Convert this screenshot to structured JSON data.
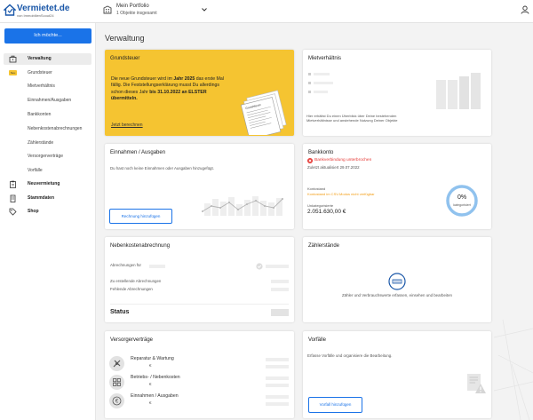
{
  "header": {
    "logo_title": "Vermietet.de",
    "logo_subtitle": "von ImmobilienScout24",
    "portfolio_title": "Mein Portfolio",
    "portfolio_subtitle": "1 Objekte insgesamt"
  },
  "sidebar": {
    "cta_label": "Ich möchte...",
    "items": [
      {
        "label": "Verwaltung",
        "active": true,
        "bold": true,
        "icon": "briefcase-icon"
      },
      {
        "label": "Grundsteuer",
        "badge": "Neu"
      },
      {
        "label": "Mietverhältnis"
      },
      {
        "label": "Einnahmen/Ausgaben"
      },
      {
        "label": "Bankkonten"
      },
      {
        "label": "Nebenkostenabrechnungen"
      },
      {
        "label": "Zählerstände"
      },
      {
        "label": "Versorgerverträge"
      },
      {
        "label": "Vorfälle"
      },
      {
        "label": "Neuvermietung",
        "bold": true,
        "icon": "clipboard-icon"
      },
      {
        "label": "Stammdaten",
        "bold": true,
        "icon": "building-icon"
      },
      {
        "label": "Shop",
        "bold": true,
        "icon": "tag-icon"
      }
    ]
  },
  "main": {
    "title": "Verwaltung",
    "grundsteuer": {
      "title": "Grundsteuer",
      "text_pre": "Die neue Grundsteuer wird im ",
      "text_bold1": "Jahr 2025",
      "text_mid": " das erste Mal fällig. Die Feststellungserklärung musst Du allerdings schon dieses Jahr ",
      "text_bold2": "bis 31.10.2022 an ELSTER übermitteln.",
      "link": "Jetzt berechnen",
      "doc_label": "Grundsteuer",
      "accent": "#f5c431"
    },
    "mietverhaeltnis": {
      "title": "Mietverhältnis",
      "text": "Hier erhältst Du einen Überblick über Deine bestehenden Mietverhältnisse und anstehende Nutzung Deiner Objekte"
    },
    "einnahmen": {
      "title": "Einnahmen / Ausgaben",
      "text": "Du hast noch keine Einnahmen oder Ausgaben hinzugefügt.",
      "button": "Rechnung hinzufügen"
    },
    "bankkonto": {
      "title": "Bankkonto",
      "error": "Bankverbindung unterbrochen",
      "updated": "Zuletzt aktualisiert 29.07.2022",
      "account_label": "Kontostand",
      "account_value": "Kontostand im CSV-Modus nicht verfügbar",
      "uncat_label": "Unkategorisierte",
      "uncat_value": "2.051.630,00 €",
      "donut_value": "0%",
      "donut_label": "kategorisiert",
      "error_color": "#e53935",
      "warn_color": "#f39c12",
      "donut_color": "#90c2ee"
    },
    "nebenkosten": {
      "title": "Nebenkostenabrechnung",
      "row1": "Abrechnungen für",
      "row2": "Zu erstellende Abrechnungen",
      "row3": "Fehlende Abrechnungen",
      "status": "Status"
    },
    "zaehler": {
      "title": "Zählerstände",
      "text": "Zähler und Verbrauchswerte erfassen, einsehen und bearbeiten"
    },
    "versorger": {
      "title": "Versorgerverträge",
      "rows": [
        {
          "label": "Reparatur & Wartung",
          "unit": "€",
          "icon": "tools-icon"
        },
        {
          "label": "Betriebs- / Nebenkosten",
          "unit": "€",
          "icon": "grid-icon"
        },
        {
          "label": "Einnahmen / Ausgaben",
          "unit": "€",
          "icon": "euro-icon"
        }
      ]
    },
    "vorfaelle": {
      "title": "Vorfälle",
      "text": "Erfasse Vorfälle und organisiere die Bearbeitung.",
      "button": "Vorfall hinzufügen"
    }
  }
}
